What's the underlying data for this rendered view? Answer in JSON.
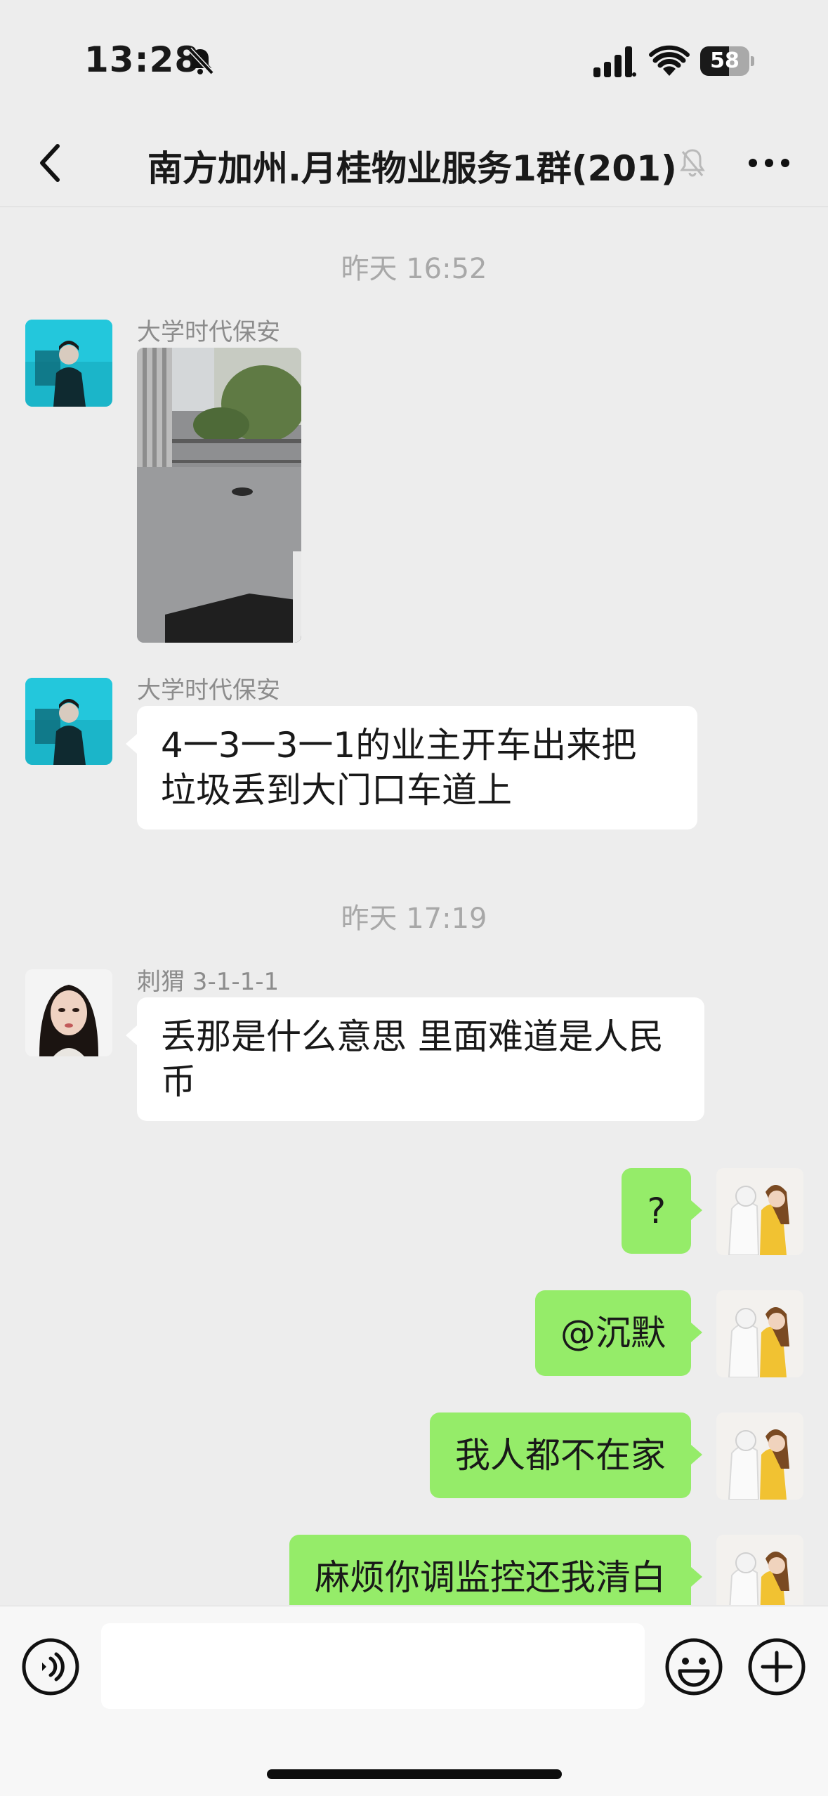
{
  "status_bar": {
    "time": "13:28",
    "battery": "58",
    "battery_level": 0.58,
    "icons": [
      "bell-slash-icon",
      "signal-icon",
      "wifi-icon",
      "battery-icon"
    ]
  },
  "nav": {
    "title": "南方加州.月桂物业服务1群(201)",
    "icons": [
      "chevron-left-icon",
      "mute-bell-icon",
      "more-icon"
    ]
  },
  "messages": [
    {
      "kind": "timestamp",
      "text": "昨天 16:52"
    },
    {
      "kind": "image",
      "side": "left",
      "sender": "大学时代保安"
    },
    {
      "kind": "text",
      "side": "left",
      "sender": "大学时代保安",
      "lines": [
        "4一3一3一1的业主开车出来把",
        "垃圾丢到大门口车道上"
      ]
    },
    {
      "kind": "timestamp",
      "text": "昨天 17:19"
    },
    {
      "kind": "text",
      "side": "left",
      "sender": "刺猬 3-1-1-1",
      "lines": [
        "丢那是什么意思 里面难道是人民",
        "币"
      ]
    },
    {
      "kind": "text",
      "side": "right",
      "text": "?"
    },
    {
      "kind": "text",
      "side": "right",
      "text": "@沉默"
    },
    {
      "kind": "text",
      "side": "right",
      "text": "我人都不在家"
    },
    {
      "kind": "text",
      "side": "right",
      "text": "麻烦你调监控还我清白"
    }
  ],
  "input_bar": {
    "value": "",
    "icons": [
      "voice-icon",
      "emoji-icon",
      "plus-icon"
    ]
  },
  "colors": {
    "background": "#ededed",
    "outgoing_bubble": "#95ec69",
    "incoming_bubble": "#ffffff"
  }
}
